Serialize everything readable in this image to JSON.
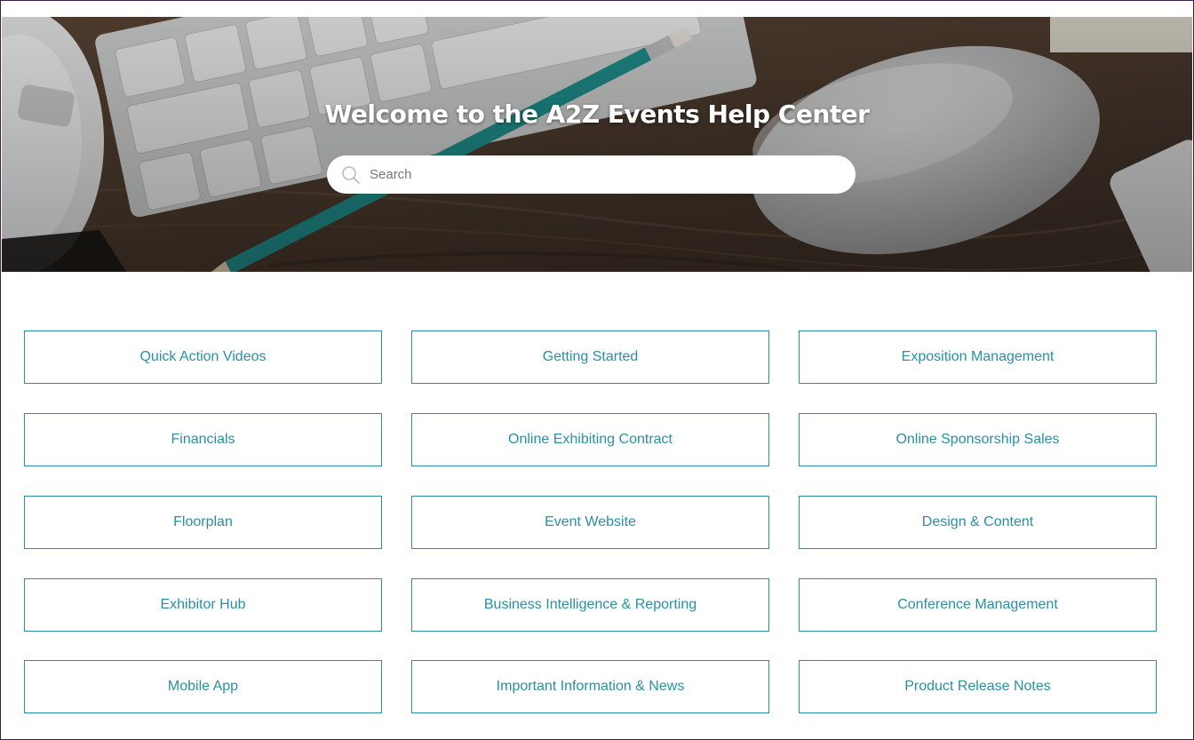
{
  "hero": {
    "title": "Welcome to the A2Z Events Help Center",
    "search_placeholder": "Search",
    "search_icon": "search-icon"
  },
  "colors": {
    "accent": "#2a8fa3",
    "frame": "#3b1f47"
  },
  "categories": [
    [
      "Quick Action Videos",
      "Getting Started",
      "Exposition Management"
    ],
    [
      "Financials",
      "Online Exhibiting Contract",
      "Online Sponsorship Sales"
    ],
    [
      "Floorplan",
      "Event Website",
      "Design & Content"
    ],
    [
      "Exhibitor Hub",
      "Business Intelligence & Reporting",
      "Conference Management"
    ],
    [
      "Mobile App",
      "Important Information & News",
      "Product Release Notes"
    ]
  ]
}
